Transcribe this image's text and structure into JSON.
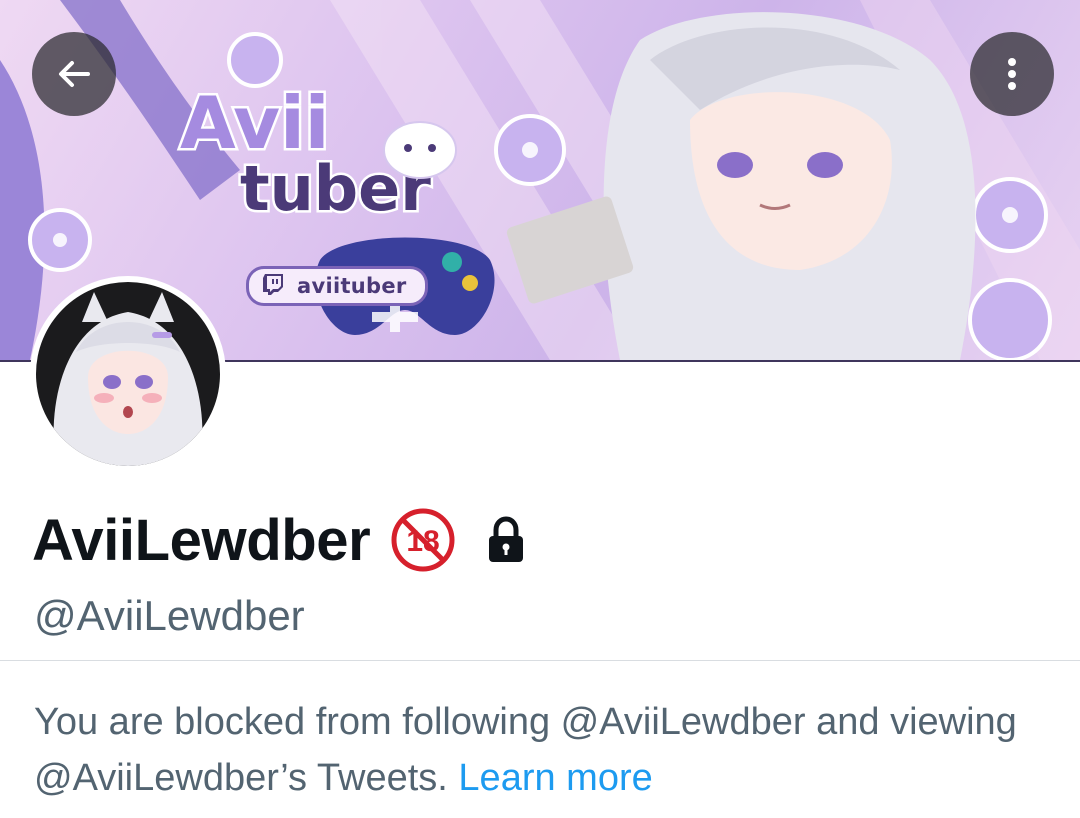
{
  "banner": {
    "logo_top": "Avii",
    "logo_bottom": "tuber",
    "twitch_handle": "aviituber",
    "twitch_icon": "twitch-icon"
  },
  "header": {
    "back_icon": "arrow-left-icon",
    "more_icon": "more-vertical-icon"
  },
  "profile": {
    "display_name": "AviiLewdber",
    "age_badge": "18",
    "handle": "@AviiLewdber",
    "lock_icon": "lock-icon"
  },
  "notice": {
    "message": "You are blocked from following @AviiLewdber and viewing @AviiLewdber’s Tweets. ",
    "learn_more": "Learn more"
  },
  "colors": {
    "name_text": "#0f1419",
    "secondary_text": "#536471",
    "link": "#1d9bf0",
    "badge_red": "#d6202c",
    "banner_purple": "#b69be6"
  }
}
